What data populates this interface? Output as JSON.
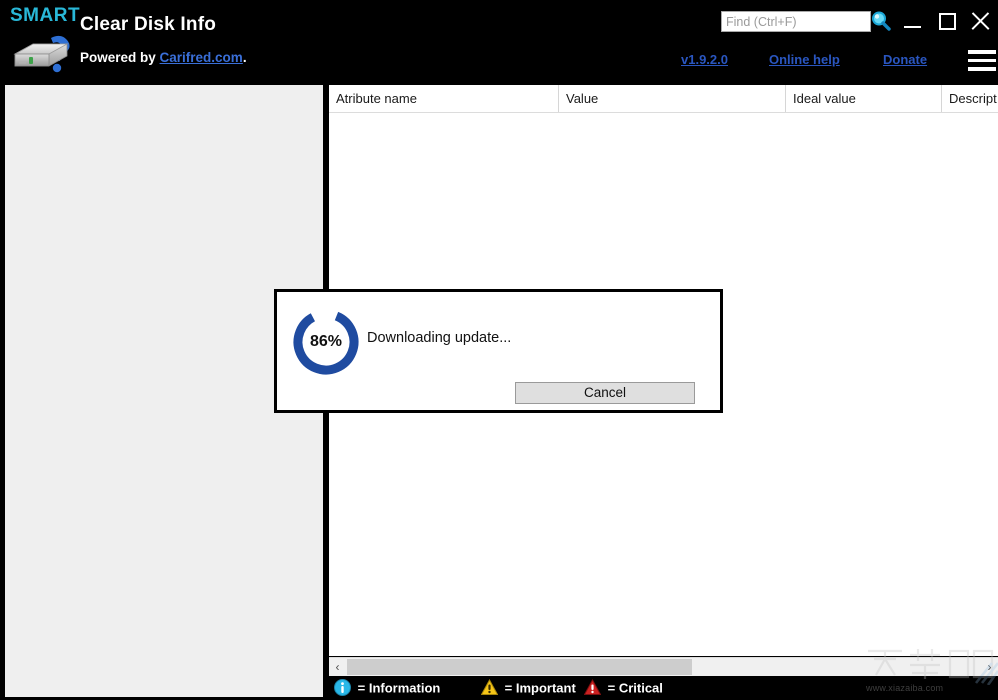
{
  "header": {
    "brand": "SMART",
    "title": "Clear Disk Info",
    "powered_prefix": "Powered by ",
    "powered_link": "Carifred.com",
    "powered_suffix": ".",
    "disk_icon": "hard-disk-question-icon",
    "search": {
      "value": "",
      "placeholder": "Find (Ctrl+F)",
      "icon": "search-icon"
    },
    "window_controls": {
      "minimize": "minimize-icon",
      "maximize": "maximize-icon",
      "close": "close-icon"
    },
    "links": {
      "version": "v1.9.2.0",
      "online_help": "Online help",
      "donate": "Donate"
    },
    "menu_icon": "hamburger-menu-icon"
  },
  "table": {
    "columns": [
      {
        "label": "Atribute name"
      },
      {
        "label": "Value"
      },
      {
        "label": "Ideal value"
      },
      {
        "label": "Descript"
      }
    ],
    "rows": []
  },
  "scrollbar": {
    "left_arrow": "‹",
    "right_arrow": "›"
  },
  "statusbar": {
    "legend": [
      {
        "icon": "information-icon",
        "label": "= Information",
        "color": "#29b8e8"
      },
      {
        "icon": "important-warning-icon",
        "label": "= Important",
        "color": "#f5c518"
      },
      {
        "icon": "critical-error-icon",
        "label": "= Critical",
        "color": "#cc2222"
      }
    ]
  },
  "watermark": {
    "site": "www.xiazaiba.com"
  },
  "dialog": {
    "percent_label": "86%",
    "percent_value": 86,
    "message": "Downloading update...",
    "cancel_label": "Cancel",
    "ring_color": "#1f4ba0",
    "ring_track_color": "#ffffff"
  },
  "colors": {
    "background": "#000000",
    "panel": "#efefef",
    "table_bg": "#ffffff",
    "accent_cyan": "#29b8d8",
    "link_blue": "#2a56c0"
  }
}
